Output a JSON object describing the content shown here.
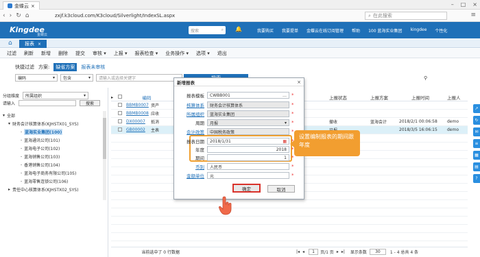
{
  "browser": {
    "tab_title": "金蝶云",
    "url": "zxjf.k3cloud.com/K3cloud/Silverlight/IndexSL.aspx",
    "search_placeholder": "在此搜索"
  },
  "header": {
    "logo": "Kingdee",
    "logo_sub": "金蝶云",
    "search_placeholder": "搜索",
    "links": [
      "我要购买",
      "我要提单",
      "金蝶云在线订阅管理",
      "帮助",
      "100 蓝海实业集团",
      "kingdee",
      "个性化"
    ]
  },
  "module_tab": {
    "label": "报表"
  },
  "toolbar": {
    "items": [
      "过滤",
      "刷新",
      "新增",
      "删除",
      "提交",
      "审核 ▾",
      "上报 ▾",
      "报表检查 ▾",
      "业务操作 ▾",
      "选项 ▾",
      "退出"
    ]
  },
  "filter": {
    "quick_filter": "快捷过滤",
    "scheme": "方案:",
    "default_scheme": "缺省方案",
    "unreported": "报表未审核",
    "field_select": "编码",
    "op_select": "包含",
    "value_placeholder": "请输入或选择关键字",
    "search_btn": "搜索"
  },
  "left_panel": {
    "dimension_label": "分组维度",
    "dimension_value": "所属组织",
    "input_label": "请输入",
    "search_btn": "搜索",
    "tree": [
      {
        "label": "全部",
        "level": 0
      },
      {
        "label": "财务会计核算体系(KJHSTX01_SYS)",
        "level": 1
      },
      {
        "label": "蓝海实业集团(100)",
        "level": 2,
        "selected": true
      },
      {
        "label": "蓝海通讯公司(101)",
        "level": 2
      },
      {
        "label": "蓝海电子公司(102)",
        "level": 2
      },
      {
        "label": "蓝海销售公司(103)",
        "level": 2
      },
      {
        "label": "香港销售公司(104)",
        "level": 2
      },
      {
        "label": "蓝海电子商务有限公司(105)",
        "level": 2
      },
      {
        "label": "蓝海零售连锁公司(106)",
        "level": 2
      },
      {
        "label": "责任中心核算体系(KJHSTX02_SYS)",
        "level": 1
      }
    ]
  },
  "grid": {
    "columns": [
      "编码",
      "上报状态",
      "上报方案",
      "上报时间",
      "上报人"
    ],
    "rows": [
      {
        "code": "BBMB0007",
        "name": "资产",
        "status": "",
        "scheme": "",
        "time": "",
        "user": ""
      },
      {
        "code": "BBMB0008",
        "name": "应收",
        "status": "",
        "scheme": "",
        "time": "",
        "user": ""
      },
      {
        "code": "DX00007",
        "name": "抵消",
        "status": "撤收",
        "scheme": "蓝海会计",
        "time": "2018/2/1 00:06:58",
        "user": "demo"
      },
      {
        "code": "GB00002",
        "name": "主表",
        "status": "已报",
        "scheme": "",
        "time": "2018/3/5 16:06:15",
        "user": "demo"
      }
    ],
    "footer": {
      "selected": "当前选中了 0 行数据",
      "page": "1",
      "page_total": "页/1 页",
      "per_page_label": "显示条数",
      "per_page": "30",
      "range": "1 - 4 总共 4 条"
    }
  },
  "modal": {
    "title": "新增报表",
    "fields": [
      {
        "label": "报表模板",
        "value": "CWBB001",
        "link": false,
        "gray": false,
        "dropdown": true
      },
      {
        "label": "核算体系",
        "value": "财务会计核算体系",
        "link": true,
        "gray": true,
        "dropdown": false
      },
      {
        "label": "所属组织",
        "value": "蓝海实业集团",
        "link": true,
        "gray": true,
        "dropdown": false
      },
      {
        "label": "周期",
        "value": "月报",
        "link": false,
        "gray": true,
        "dropdown": true
      },
      {
        "label": "会计政策",
        "value": "中国税务政策",
        "link": true,
        "gray": true,
        "dropdown": false
      },
      {
        "label": "报表日期",
        "value": "2018/1/31",
        "link": false,
        "gray": false,
        "dropdown": false
      },
      {
        "label": "年度",
        "value": "2018",
        "link": false,
        "gray": false,
        "dropdown": false
      },
      {
        "label": "期间",
        "value": "1",
        "link": false,
        "gray": false,
        "dropdown": false
      },
      {
        "label": "币别",
        "value": "人民币",
        "link": true,
        "gray": false,
        "dropdown": false
      },
      {
        "label": "金额单位",
        "value": "元",
        "link": true,
        "gray": false,
        "dropdown": false
      }
    ],
    "ok": "确定",
    "cancel": "取消"
  },
  "callout": {
    "text": "设置编制报表的期间跟年度"
  }
}
